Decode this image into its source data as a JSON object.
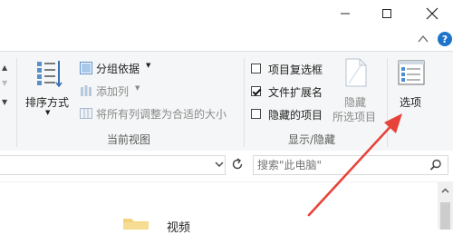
{
  "window": {
    "minimize_icon": "minimize-icon",
    "maximize_icon": "maximize-icon",
    "close_icon": "close-icon"
  },
  "ribbon": {
    "layout_group": {
      "sort_label": "排序方式",
      "group_by_label": "分组依据",
      "add_column_label": "添加列",
      "fit_columns_label": "将所有列调整为合适的大小",
      "group_title": "当前视图"
    },
    "show_hide_group": {
      "item_checkboxes_label": "项目复选框",
      "item_checkboxes_checked": false,
      "file_ext_label": "文件扩展名",
      "file_ext_checked": true,
      "hidden_items_label": "隐藏的项目",
      "hidden_items_checked": false,
      "hide_selected_line1": "隐藏",
      "hide_selected_line2": "所选项目",
      "group_title": "显示/隐藏"
    },
    "options_label": "选项"
  },
  "search": {
    "placeholder": "搜索\"此电脑\""
  },
  "content": {
    "first_item_label": "视频"
  },
  "annotation": {
    "arrow_color": "#e8433a"
  }
}
